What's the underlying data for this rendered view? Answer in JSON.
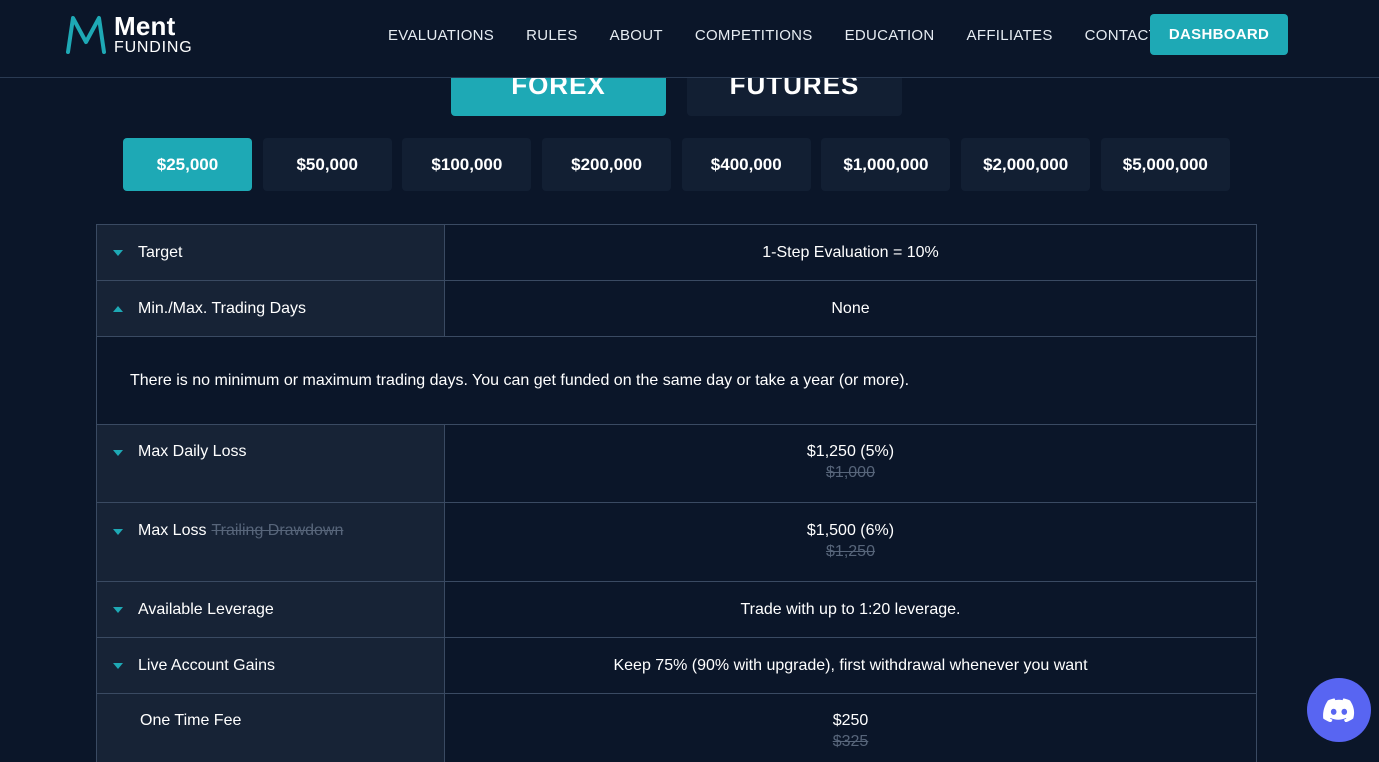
{
  "brand": {
    "name_line1": "Ment",
    "name_line2": "FUNDING",
    "accent": "#1ea9b5"
  },
  "nav": {
    "items": [
      "EVALUATIONS",
      "RULES",
      "ABOUT",
      "COMPETITIONS",
      "EDUCATION",
      "AFFILIATES",
      "CONTACT"
    ],
    "dashboard": "DASHBOARD"
  },
  "market_tabs": {
    "forex": "FOREX",
    "futures": "FUTURES",
    "active": "FOREX"
  },
  "account_sizes": {
    "items": [
      "$25,000",
      "$50,000",
      "$100,000",
      "$200,000",
      "$400,000",
      "$1,000,000",
      "$2,000,000",
      "$5,000,000"
    ],
    "active": "$25,000"
  },
  "rules": {
    "target": {
      "label": "Target",
      "value": "1-Step Evaluation = 10%",
      "caret": "down"
    },
    "trading_days": {
      "label": "Min./Max. Trading Days",
      "value": "None",
      "caret": "up",
      "details": "There is no minimum or maximum trading days. You can get funded on the same day or take a year (or more)."
    },
    "max_daily_loss": {
      "label": "Max Daily Loss",
      "value": "$1,250 (5%)",
      "old_value": "$1,000",
      "caret": "down"
    },
    "max_loss": {
      "label": "Max Loss",
      "label_strike": "Trailing Drawdown",
      "value": "$1,500 (6%)",
      "old_value": "$1,250",
      "caret": "down"
    },
    "leverage": {
      "label": "Available Leverage",
      "value": "Trade with up to 1:20 leverage.",
      "caret": "down"
    },
    "gains": {
      "label": "Live Account Gains",
      "value": "Keep 75% (90% with upgrade), first withdrawal whenever you want",
      "caret": "down"
    },
    "fee": {
      "label": "One Time Fee",
      "value": "$250",
      "old_value": "$325"
    }
  },
  "discord": {
    "icon": "discord-icon",
    "color": "#5865f2"
  }
}
